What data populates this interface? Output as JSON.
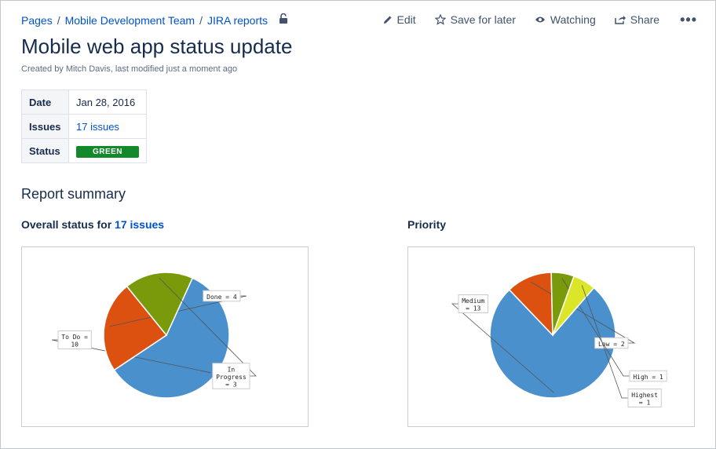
{
  "breadcrumb": {
    "items": [
      "Pages",
      "Mobile Development Team",
      "JIRA reports"
    ],
    "separator": "/"
  },
  "actions": {
    "edit": "Edit",
    "save": "Save for later",
    "watching": "Watching",
    "share": "Share",
    "more": "•••"
  },
  "page": {
    "title": "Mobile web app status update",
    "byline": "Created by Mitch Davis, last modified just a moment ago"
  },
  "meta": {
    "date_label": "Date",
    "date_value": "Jan 28, 2016",
    "issues_label": "Issues",
    "issues_value": "17 issues",
    "status_label": "Status",
    "status_value": "GREEN",
    "status_color": "#14892c"
  },
  "report": {
    "heading": "Report summary",
    "left_heading_prefix": "Overall status for ",
    "left_heading_link": "17 issues",
    "right_heading": "Priority"
  },
  "colors": {
    "link": "#0052cc",
    "blue": "#4a90cc",
    "orange": "#dc5010",
    "green": "#799b0b",
    "yellow": "#dce628"
  },
  "chart_data": [
    {
      "type": "pie",
      "title": "Overall status for 17 issues",
      "slices": [
        {
          "label": "To Do",
          "value": 10,
          "color": "#4a90cc",
          "display": [
            "To Do =",
            "10"
          ]
        },
        {
          "label": "Done",
          "value": 4,
          "color": "#dc5010",
          "display": [
            "Done = 4"
          ]
        },
        {
          "label": "In Progress",
          "value": 3,
          "color": "#799b0b",
          "display": [
            "In",
            "Progress",
            "= 3"
          ]
        }
      ]
    },
    {
      "type": "pie",
      "title": "Priority",
      "slices": [
        {
          "label": "Medium",
          "value": 13,
          "color": "#4a90cc",
          "display": [
            "Medium",
            "= 13"
          ]
        },
        {
          "label": "Low",
          "value": 2,
          "color": "#dc5010",
          "display": [
            "Low = 2"
          ]
        },
        {
          "label": "High",
          "value": 1,
          "color": "#799b0b",
          "display": [
            "High = 1"
          ]
        },
        {
          "label": "Highest",
          "value": 1,
          "color": "#dce628",
          "display": [
            "Highest",
            "= 1"
          ]
        }
      ]
    }
  ]
}
